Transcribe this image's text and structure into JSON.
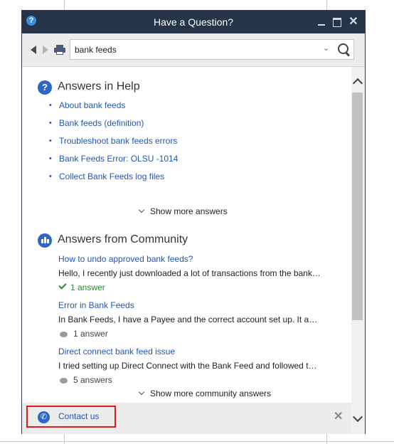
{
  "window": {
    "title": "Have a Question?"
  },
  "toolbar": {
    "search_value": "bank feeds"
  },
  "help_section": {
    "title": "Answers in Help",
    "links": [
      "About bank feeds",
      "Bank feeds (definition)",
      "Troubleshoot bank feeds errors",
      "Bank Feeds Error: OLSU -1014",
      "Collect Bank Feeds log files"
    ],
    "show_more": "Show more answers"
  },
  "community_section": {
    "title": "Answers from Community",
    "items": [
      {
        "title": "How to undo approved bank feeds?",
        "snippet": "Hello, I recently just downloaded a lot of transactions from the bank…",
        "answers": "1 answer",
        "accepted": true
      },
      {
        "title": "Error in Bank Feeds",
        "snippet": "In Bank Feeds, I have a Payee and the correct account set up. It a…",
        "answers": "1 answer",
        "accepted": false
      },
      {
        "title": "Direct connect bank feed issue",
        "snippet": "I tried setting up Direct Connect with the Bank Feed and followed t…",
        "answers": "5 answers",
        "accepted": false
      }
    ],
    "show_more": "Show more community answers"
  },
  "footer": {
    "contact_label": "Contact us"
  },
  "colors": {
    "titlebar": "#263449",
    "link": "#2256b8",
    "accent_icon": "#2c66c6",
    "highlight_border": "#e01b1b",
    "accepted": "#2e8a2e"
  },
  "icons": {
    "help": "question-circle-icon",
    "community": "community-icon",
    "phone": "phone-icon",
    "search": "magnifier-icon",
    "print": "printer-icon"
  }
}
